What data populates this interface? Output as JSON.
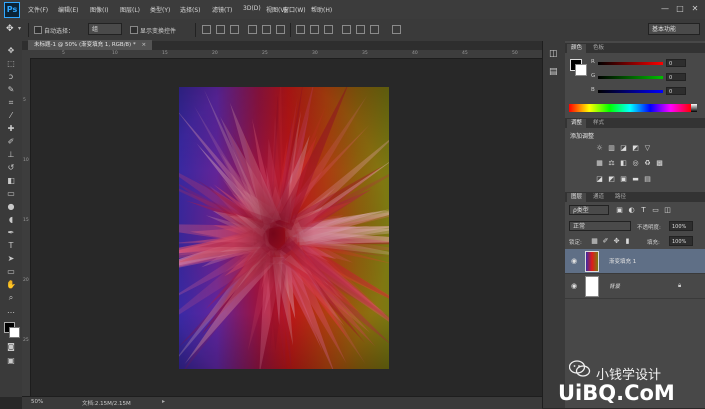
{
  "app": {
    "logo": "Ps"
  },
  "menu": [
    "文件(F)",
    "编辑(E)",
    "图像(I)",
    "图层(L)",
    "类型(Y)",
    "选择(S)",
    "滤镜(T)",
    "3D(D)",
    "视图(V)",
    "窗口(W)",
    "帮助(H)"
  ],
  "window_controls": [
    "—",
    "□",
    "✕"
  ],
  "options": {
    "auto_select_label": "自动选择：",
    "auto_select_value": "组",
    "show_transform_label": "显示变换控件",
    "workspace_preset": "基本功能"
  },
  "document": {
    "tab_title": "未标题-1 @ 50% (渐变填充 1, RGB/8) *",
    "close": "×",
    "zoom": "50%",
    "doc_size": "文档:2.15M/2.15M"
  },
  "rulers": {
    "top": [
      "5",
      "10",
      "15",
      "20",
      "25",
      "30",
      "35",
      "40",
      "45",
      "50"
    ],
    "left": [
      "5",
      "10",
      "15",
      "20",
      "25"
    ]
  },
  "panels": {
    "color": {
      "tabs": [
        "颜色",
        "色板"
      ],
      "channels": [
        {
          "label": "R",
          "value": "0",
          "color": "#ff0000"
        },
        {
          "label": "G",
          "value": "0",
          "color": "#00c000"
        },
        {
          "label": "B",
          "value": "0",
          "color": "#0000ff"
        }
      ]
    },
    "adjustments": {
      "tabs": [
        "调整",
        "样式"
      ],
      "title": "添加调整"
    },
    "layers": {
      "tabs": [
        "图层",
        "通道",
        "路径"
      ],
      "filter_kind": "ρ类型",
      "blend_mode": "正常",
      "opacity_label": "不透明度:",
      "opacity_value": "100%",
      "lock_label": "锁定:",
      "fill_label": "填充:",
      "fill_value": "100%",
      "items": [
        {
          "name": "渐变填充 1",
          "selected": true
        },
        {
          "name": "背景",
          "selected": false
        }
      ]
    }
  },
  "watermark": {
    "text": "小钱学设计",
    "url": "UiBQ.CoM"
  },
  "colors": {
    "accent": "#31a8ff",
    "panel_bg": "#484848",
    "selected_layer": "#5f6f86"
  }
}
